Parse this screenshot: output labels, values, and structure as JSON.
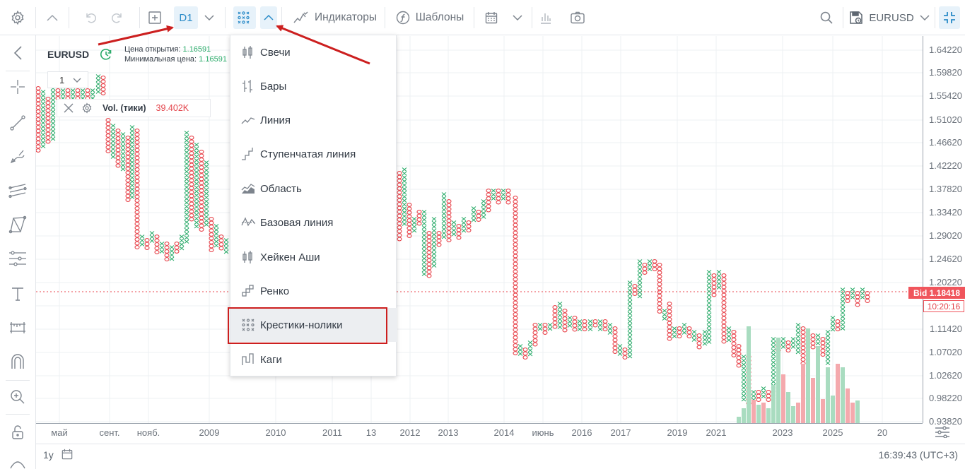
{
  "toolbar": {
    "timeframe": "D1",
    "indicators_label": "Индикаторы",
    "templates_label": "Шаблоны",
    "symbol": "EURUSD"
  },
  "legend": {
    "symbol": "EURUSD",
    "open_label": "Цена открытия:",
    "open_value": "1.16591",
    "low_label": "Минимальная цена:",
    "low_value": "1.16591",
    "pane_value": "1",
    "vol_label": "Vol. (тики)",
    "vol_value": "39.402K"
  },
  "chart_types": [
    {
      "label": "Свечи",
      "icon": "candles-icon"
    },
    {
      "label": "Бары",
      "icon": "bars-icon"
    },
    {
      "label": "Линия",
      "icon": "line-icon"
    },
    {
      "label": "Ступенчатая линия",
      "icon": "step-line-icon"
    },
    {
      "label": "Область",
      "icon": "area-icon"
    },
    {
      "label": "Базовая линия",
      "icon": "baseline-icon"
    },
    {
      "label": "Хейкен Аши",
      "icon": "heikin-ashi-icon"
    },
    {
      "label": "Ренко",
      "icon": "renko-icon"
    },
    {
      "label": "Крестики-нолики",
      "icon": "point-figure-icon",
      "selected": true
    },
    {
      "label": "Каги",
      "icon": "kagi-icon"
    }
  ],
  "price_axis": [
    "1.64220",
    "1.59820",
    "1.55420",
    "1.51020",
    "1.46620",
    "1.42220",
    "1.37820",
    "1.33420",
    "1.29020",
    "1.24620",
    "1.20220",
    "1.11420",
    "1.07020",
    "1.02620",
    "0.98220",
    "0.93820"
  ],
  "time_axis": [
    "май",
    "сент.",
    "нояб.",
    "2009",
    "2010",
    "2011",
    "13",
    "2012",
    "2013",
    "2014",
    "июнь",
    "2016",
    "2017",
    "2019",
    "2021",
    "2023",
    "2025",
    "20"
  ],
  "bid": {
    "label": "Bid 1.18418",
    "countdown": "10:20:16"
  },
  "bottom": {
    "range": "1y",
    "clock": "16:39:43 (UTC+3)"
  },
  "colors": {
    "up": "#2bab6a",
    "down": "#e8454c",
    "accent": "#2a8bc8",
    "highlight": "#cc1f1f"
  }
}
